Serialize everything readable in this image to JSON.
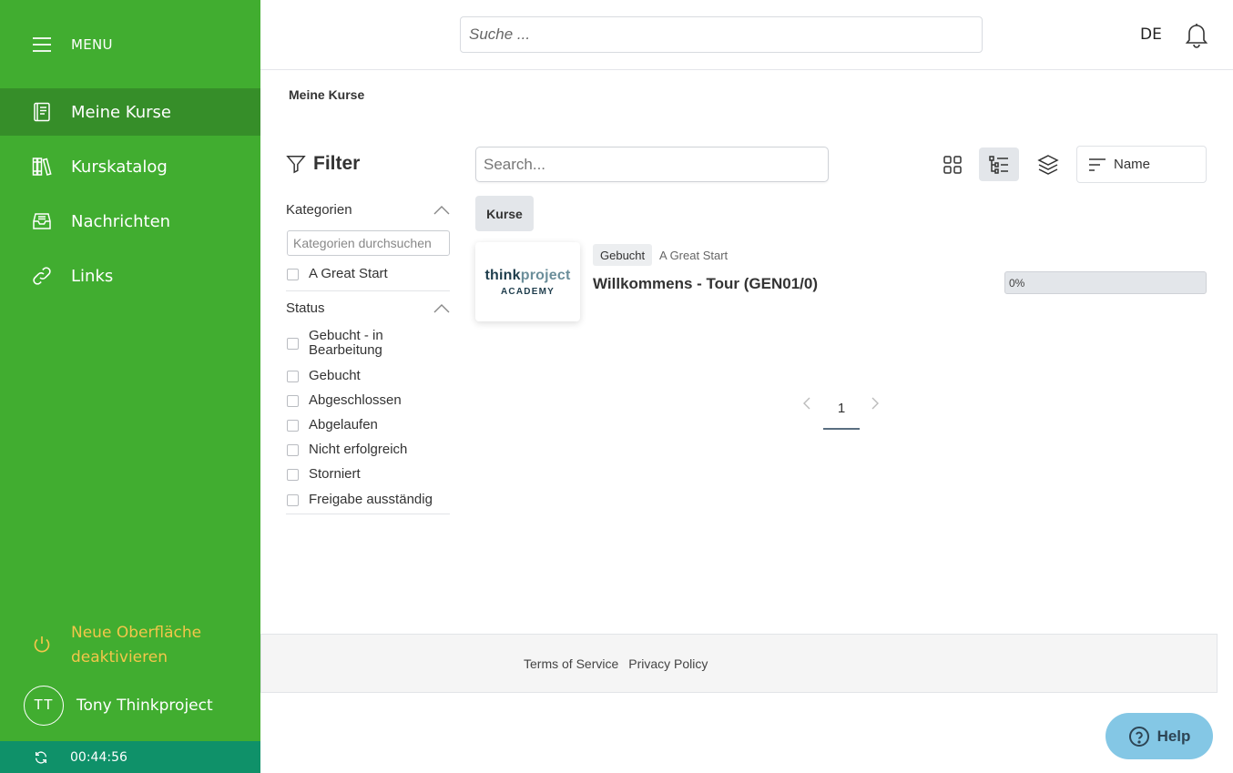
{
  "sidebar": {
    "menu_label": "MENU",
    "items": [
      {
        "label": "Meine Kurse",
        "icon": "book-icon",
        "active": true
      },
      {
        "label": "Kurskatalog",
        "icon": "library-icon",
        "active": false
      },
      {
        "label": "Nachrichten",
        "icon": "inbox-icon",
        "active": false
      },
      {
        "label": "Links",
        "icon": "link-icon",
        "active": false
      }
    ],
    "deactivate_label": "Neue Oberfläche deaktivieren",
    "user": {
      "initials": "TT",
      "name": "Tony Thinkproject"
    },
    "session_time": "00:44:56",
    "colors": {
      "background": "#41ad30",
      "active": "#368e29",
      "session_bar": "#0f9169",
      "warning_text": "#f3c64a"
    }
  },
  "header": {
    "search_placeholder": "Suche ...",
    "language": "DE"
  },
  "breadcrumb": "Meine Kurse",
  "filter": {
    "title": "Filter",
    "categories": {
      "heading": "Kategorien",
      "search_placeholder": "Kategorien durchsuchen",
      "options": [
        "A Great Start"
      ]
    },
    "status": {
      "heading": "Status",
      "options": [
        "Gebucht - in Bearbeitung",
        "Gebucht",
        "Abgeschlossen",
        "Abgelaufen",
        "Nicht erfolgreich",
        "Storniert",
        "Freigabe ausständig"
      ]
    }
  },
  "content": {
    "search_placeholder": "Search...",
    "sort_label": "Name",
    "tab_label": "Kurse",
    "course": {
      "logo_think": "think",
      "logo_project": "project",
      "logo_sub": "ACADEMY",
      "badge": "Gebucht",
      "category": "A Great Start",
      "title": "Willkommens - Tour (GEN01/0)",
      "progress_percent": 0,
      "progress_label": "0%"
    },
    "pagination": {
      "current": "1"
    }
  },
  "footer": {
    "terms": "Terms of Service",
    "privacy": "Privacy Policy"
  },
  "help": {
    "label": "Help",
    "color": "#84c7e5"
  }
}
